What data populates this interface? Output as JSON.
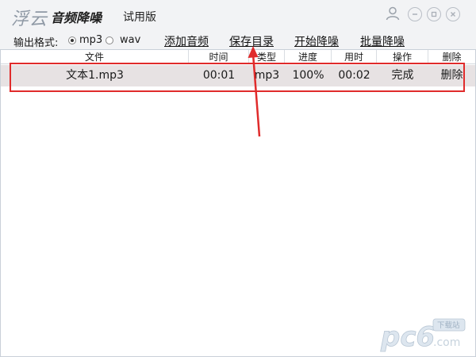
{
  "app": {
    "logo": "浮云",
    "name": "音频降噪",
    "edition": "试用版"
  },
  "window_controls": [
    "user-icon",
    "minimize-icon",
    "restore-icon",
    "close-icon"
  ],
  "toolbar": {
    "format_label": "输出格式:",
    "formats": [
      {
        "label": "mp3",
        "selected": true
      },
      {
        "label": "wav",
        "selected": false
      }
    ],
    "add_audio": "添加音频",
    "save_dir": "保存目录",
    "start_denoise": "开始降噪",
    "batch_denoise": "批量降噪"
  },
  "table": {
    "columns": [
      "文件",
      "时间",
      "类型",
      "进度",
      "用时",
      "操作",
      "删除"
    ],
    "rows": [
      [
        "文本1.mp3",
        "00:01",
        "mp3",
        "100%",
        "00:02",
        "完成",
        "删除"
      ]
    ]
  },
  "annotation": {
    "color": "#e02b2b"
  },
  "watermark": {
    "text": "pc6",
    "sub": "下载站",
    "domain": ".com"
  }
}
